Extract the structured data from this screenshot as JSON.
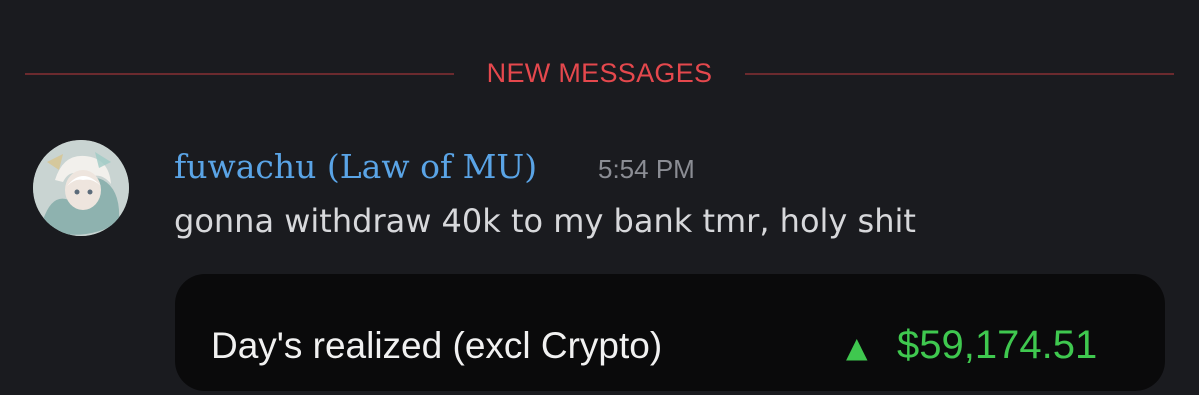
{
  "divider": {
    "label": "NEW MESSAGES",
    "color": "#e5484d"
  },
  "message": {
    "username": "fuwachu (Law of MU)",
    "username_color": "#5aa4e6",
    "timestamp": "5:54 PM",
    "text": "gonna withdraw 40k to my bank tmr, holy shit",
    "avatar_icon": "anime-character-avatar"
  },
  "embed": {
    "label": "Day's realized (excl Crypto)",
    "arrow_icon": "up-triangle-icon",
    "arrow_glyph": "▲",
    "value": "$59,174.51",
    "value_color": "#3fc84f"
  }
}
